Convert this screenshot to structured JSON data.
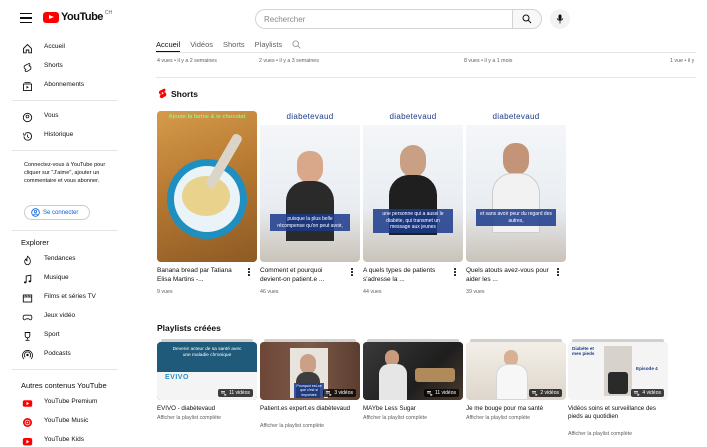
{
  "header": {
    "logo_text": "YouTube",
    "logo_country": "CH",
    "search_placeholder": "Rechercher"
  },
  "sidebar": {
    "primary": [
      {
        "label": "Accueil",
        "icon": "home-icon"
      },
      {
        "label": "Shorts",
        "icon": "shorts-icon"
      },
      {
        "label": "Abonnements",
        "icon": "subscriptions-icon"
      }
    ],
    "you": [
      {
        "label": "Vous",
        "icon": "you-icon"
      },
      {
        "label": "Historique",
        "icon": "history-icon"
      }
    ],
    "signin_note": "Connectez-vous à YouTube pour cliquer sur \"J'aime\", ajouter un commentaire et vous abonner.",
    "signin_label": "Se connecter",
    "explore_title": "Explorer",
    "explore": [
      {
        "label": "Tendances",
        "icon": "trending-icon"
      },
      {
        "label": "Musique",
        "icon": "music-icon"
      },
      {
        "label": "Films et séries TV",
        "icon": "movies-icon"
      },
      {
        "label": "Jeux vidéo",
        "icon": "gaming-icon"
      },
      {
        "label": "Sport",
        "icon": "trophy-icon"
      },
      {
        "label": "Podcasts",
        "icon": "podcast-icon"
      }
    ],
    "more_title": "Autres contenus YouTube",
    "more": [
      {
        "label": "YouTube Premium",
        "icon": "youtube-premium-icon"
      },
      {
        "label": "YouTube Music",
        "icon": "youtube-music-icon"
      },
      {
        "label": "YouTube Kids",
        "icon": "youtube-kids-icon"
      }
    ]
  },
  "tabs": [
    "Accueil",
    "Vidéos",
    "Shorts",
    "Playlists"
  ],
  "top_meta": [
    "4 vues • il y a 2 semaines",
    "2 vues • il y a 3 semaines",
    "8 vues • il y a 1 mois",
    "1 vue • il y"
  ],
  "shorts_title": "Shorts",
  "shorts": [
    {
      "title": "Banana bread par Tatiana Elisa Martins -...",
      "views": "9 vues",
      "overlay": "Ajoute la farine & le chocolat"
    },
    {
      "title": "Comment et pourquoi devient-on patient.e ...",
      "views": "46 vues",
      "brand": "diabetevaud",
      "caption": "puisque la plus belle récompense qu'on peut avoir,"
    },
    {
      "title": "A quels types de patients s'adresse la ...",
      "views": "44 vues",
      "brand": "diabetevaud",
      "caption": "une personne qui a aussi le diabète, qui transmet un message aux jeunes"
    },
    {
      "title": "Quels atouts avez-vous pour aider les ...",
      "views": "39 vues",
      "brand": "diabetevaud",
      "caption": "et sans avoir peur du regard des autres,"
    }
  ],
  "playlists_title": "Playlists créées",
  "playlists": [
    {
      "title": "EVIVO - diabètevaud",
      "count": "11 vidéos",
      "link": "Afficher la playlist complète",
      "thumb_text": "Devenir acteur de sa santé avec une maladie chronique",
      "thumb_brand": "EVIVO"
    },
    {
      "title": "Patient.es expert.es diabètevaud",
      "count": "3 vidéos",
      "link": "Afficher la playlist complète",
      "thumb_caption": "Pourquoi est-ce que c'est si important"
    },
    {
      "title": "MAYbe Less Sugar",
      "count": "11 vidéos",
      "link": "Afficher la playlist complète"
    },
    {
      "title": "Je me bouge pour ma santé",
      "count": "2 vidéos",
      "link": "Afficher la playlist complète"
    },
    {
      "title": "Vidéos soins et surveillance des pieds au quotidien",
      "count": "4 vidéos",
      "link": "Afficher la playlist complète",
      "thumb_text": "Diabète et mes pieds",
      "thumb_episode": "Episode 4"
    }
  ]
}
